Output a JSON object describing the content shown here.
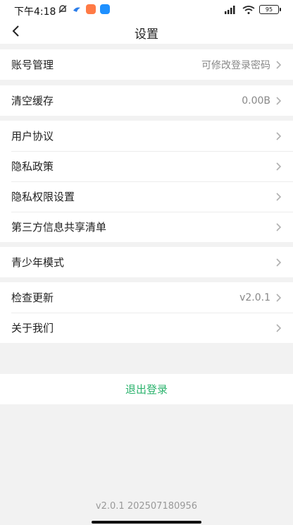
{
  "status_bar": {
    "time": "下午4:18",
    "battery": "95",
    "signal": "HD"
  },
  "nav": {
    "title": "设置"
  },
  "groups": [
    {
      "items": [
        {
          "label": "账号管理",
          "value": "可修改登录密码"
        }
      ]
    },
    {
      "items": [
        {
          "label": "清空缓存",
          "value": "0.00B"
        }
      ]
    },
    {
      "items": [
        {
          "label": "用户协议",
          "value": ""
        },
        {
          "label": "隐私政策",
          "value": ""
        },
        {
          "label": "隐私权限设置",
          "value": ""
        },
        {
          "label": "第三方信息共享清单",
          "value": ""
        }
      ]
    },
    {
      "items": [
        {
          "label": "青少年模式",
          "value": ""
        }
      ]
    },
    {
      "items": [
        {
          "label": "检查更新",
          "value": "v2.0.1"
        },
        {
          "label": "关于我们",
          "value": ""
        }
      ]
    }
  ],
  "logout_label": "退出登录",
  "footer_version": "v2.0.1 202507180956",
  "colors": {
    "accent": "#2bb36d",
    "background": "#f2f2f2"
  }
}
